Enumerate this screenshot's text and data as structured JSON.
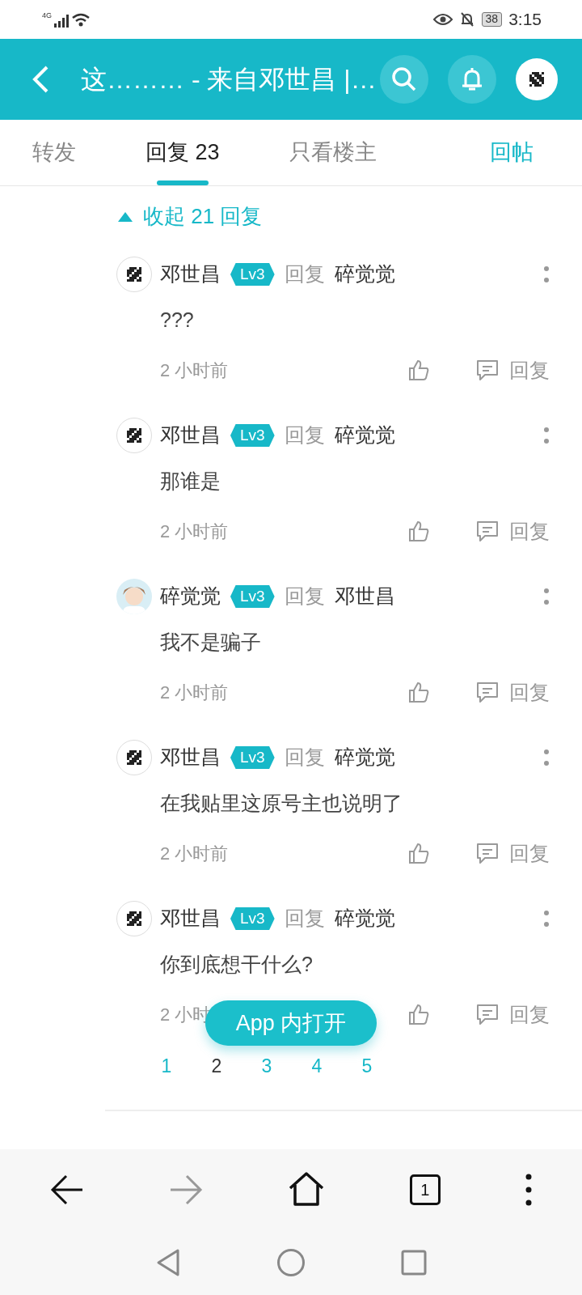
{
  "status_bar": {
    "network": "4G",
    "battery": "38",
    "time": "3:15"
  },
  "header": {
    "title": "这……… - 来自邓世昌 |…"
  },
  "tabs": [
    {
      "label": "转发",
      "selected": false
    },
    {
      "label": "回复 23",
      "selected": true
    },
    {
      "label": "只看楼主",
      "selected": false
    }
  ],
  "reply_post_button": "回帖",
  "collapse": {
    "label": "收起 21 回复",
    "expanded": true
  },
  "comments": [
    {
      "kind": "pattern",
      "user": "邓世昌",
      "level": "Lv3",
      "reply_word": "回复",
      "target": "碎觉觉",
      "text": "???",
      "time": "2 小时前",
      "reply": "回复"
    },
    {
      "kind": "pattern",
      "user": "邓世昌",
      "level": "Lv3",
      "reply_word": "回复",
      "target": "碎觉觉",
      "text": "那谁是",
      "time": "2 小时前",
      "reply": "回复"
    },
    {
      "user": "碎觉觉",
      "level": "Lv3",
      "reply_word": "回复",
      "target": "邓世昌",
      "text": "我不是骗子",
      "time": "2 小时前",
      "reply": "回复"
    },
    {
      "kind": "pattern",
      "user": "邓世昌",
      "level": "Lv3",
      "reply_word": "回复",
      "target": "碎觉觉",
      "text": "在我贴里这原号主也说明了",
      "time": "2 小时前",
      "reply": "回复"
    },
    {
      "kind": "pattern",
      "user": "邓世昌",
      "level": "Lv3",
      "reply_word": "回复",
      "target": "碎觉觉",
      "text": "你到底想干什么?",
      "time": "2 小时",
      "reply": "回复"
    }
  ],
  "pages": [
    {
      "label": "1",
      "selected": false
    },
    {
      "label": "2",
      "selected": true
    },
    {
      "label": "3",
      "selected": false
    },
    {
      "label": "4",
      "selected": false
    },
    {
      "label": "5",
      "selected": false
    }
  ],
  "open_in_app": "App 内打开",
  "browser_bar": {
    "tab_count": "1"
  }
}
